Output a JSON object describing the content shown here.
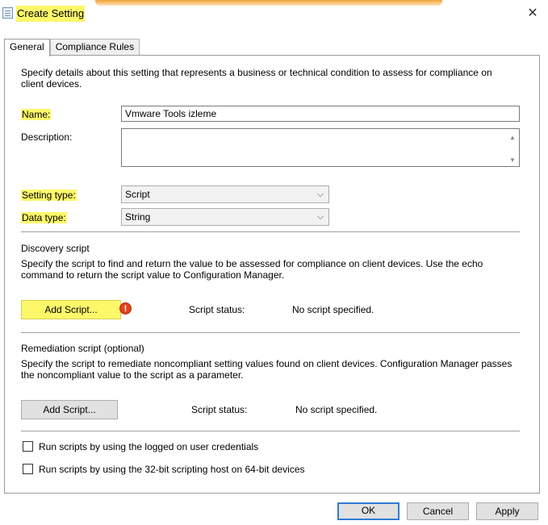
{
  "window": {
    "title": "Create Setting",
    "close_glyph": "✕"
  },
  "tabs": [
    {
      "label": "General",
      "active": true
    },
    {
      "label": "Compliance Rules",
      "active": false
    }
  ],
  "general": {
    "intro": "Specify details about this setting that represents a business or technical condition to assess for compliance on client devices.",
    "name_label": "Name:",
    "name_value": "Vmware Tools izleme",
    "description_label": "Description:",
    "description_value": "",
    "setting_type_label": "Setting type:",
    "setting_type_value": "Script",
    "data_type_label": "Data type:",
    "data_type_value": "String"
  },
  "discovery": {
    "heading": "Discovery script",
    "help": "Specify the script to find and return the value to be assessed for compliance on client devices. Use the echo command to return the script value to Configuration Manager.",
    "add_button": "Add Script...",
    "status_label": "Script status:",
    "status_value": "No script specified.",
    "warning_glyph": "!"
  },
  "remediation": {
    "heading": "Remediation script (optional)",
    "help": "Specify the script to remediate noncompliant setting values found on client devices. Configuration Manager passes the noncompliant value to the script as a parameter.",
    "add_button": "Add Script...",
    "status_label": "Script status:",
    "status_value": "No script specified."
  },
  "options": {
    "logged_on_credentials": {
      "label": "Run scripts by using the logged on user credentials",
      "checked": false
    },
    "scripting_host_32bit": {
      "label": "Run scripts by using the 32-bit scripting host on 64-bit devices",
      "checked": false
    }
  },
  "buttons": {
    "ok": "OK",
    "cancel": "Cancel",
    "apply": "Apply"
  },
  "colors": {
    "highlight": "#fdf86a",
    "accent_border": "#2f7cd3",
    "warning": "#e0441d"
  },
  "icons": {
    "app": "setting-document-icon",
    "close": "close-icon",
    "warning": "error-warning-icon",
    "dropdown": "chevron-down-icon"
  }
}
